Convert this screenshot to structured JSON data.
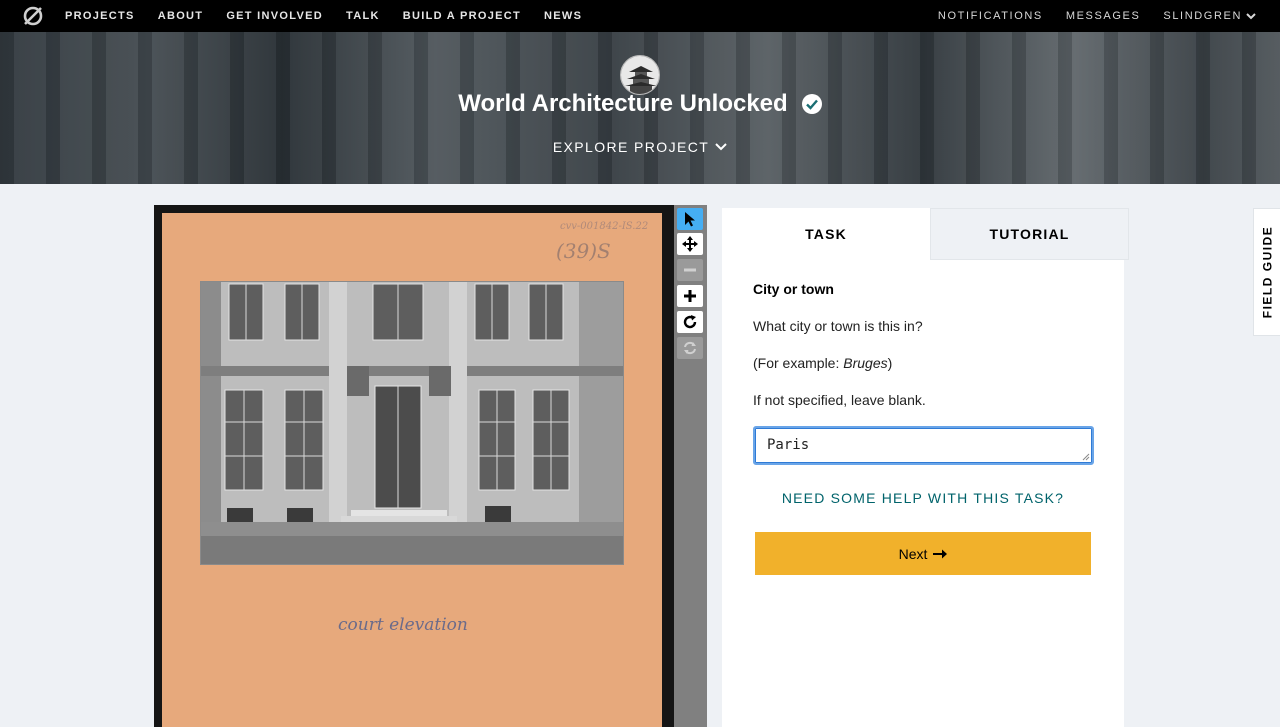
{
  "nav": {
    "left_items": [
      "PROJECTS",
      "ABOUT",
      "GET INVOLVED",
      "TALK",
      "BUILD A PROJECT",
      "NEWS"
    ],
    "right_items": [
      "NOTIFICATIONS",
      "MESSAGES"
    ],
    "user": "SLINDGREN"
  },
  "project": {
    "title": "World Architecture Unlocked",
    "explore_label": "EXPLORE PROJECT"
  },
  "subject": {
    "code_text": "cvv-001842-IS.22",
    "number_text": "(39)S",
    "caption_text": "court elevation"
  },
  "tools": [
    "pointer-icon",
    "move-icon",
    "zoom-out-icon",
    "zoom-in-icon",
    "rotate-icon",
    "reset-icon"
  ],
  "task": {
    "tab_task": "TASK",
    "tab_tutorial": "TUTORIAL",
    "question_title": "City or town",
    "question_text": "What city or town is this in?",
    "example_prefix": "(For example: ",
    "example_value": "Bruges",
    "example_suffix": ")",
    "instruction": "If not specified, leave blank.",
    "answer_value": "Paris",
    "help_label": "NEED SOME HELP WITH THIS TASK?",
    "next_label": "Next"
  },
  "field_guide_label": "FIELD GUIDE",
  "colors": {
    "accent_blue": "#45aef3",
    "next_button": "#f1b12b",
    "help_link": "#00636b",
    "nav_bg": "#000000"
  }
}
